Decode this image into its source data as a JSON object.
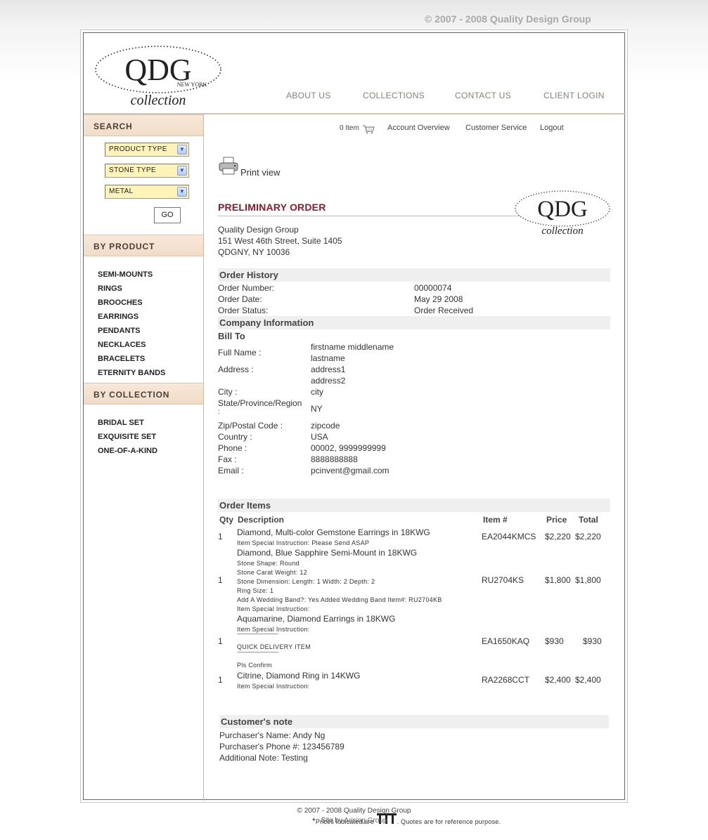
{
  "top_copyright": "© 2007 - 2008 Quality Design Group",
  "logo": {
    "main": "QDG",
    "sub": "NEW YORK",
    "script": "collection"
  },
  "nav": [
    "ABOUT US",
    "COLLECTIONS",
    "CONTACT US",
    "CLIENT LOGIN"
  ],
  "sidebar": {
    "search_heading": "SEARCH",
    "selects": [
      "PRODUCT TYPE",
      "STONE TYPE",
      "METAL"
    ],
    "go_label": "GO",
    "by_product_heading": "BY PRODUCT",
    "products": [
      "SEMI-MOUNTS",
      "RINGS",
      "BROOCHES",
      "EARRINGS",
      "PENDANTS",
      "NECKLACES",
      "BRACELETS",
      "ETERNITY BANDS"
    ],
    "by_collection_heading": "BY COLLECTION",
    "collections": [
      "BRIDAL SET",
      "EXQUISITE SET",
      "ONE-OF-A-KIND"
    ]
  },
  "topnav": {
    "cart": "0 Item",
    "account": "Account Overview",
    "service": "Customer Service",
    "logout": "Logout"
  },
  "print_view": "Print view",
  "title": "PRELIMINARY ORDER",
  "company_address": [
    "Quality Design Group",
    "151 West 46th Street, Suite 1405",
    "QDGNY, NY 10036"
  ],
  "order_history": {
    "heading": "Order History",
    "rows": [
      {
        "label": "Order Number:",
        "value": "00000074"
      },
      {
        "label": "Order Date:",
        "value": "May 29 2008"
      },
      {
        "label": "Order Status:",
        "value": "Order Received"
      }
    ]
  },
  "company_info": {
    "heading": "Company Information",
    "bill_to": "Bill To",
    "full_name_label": "Full Name :",
    "full_name": [
      "firstname middlename",
      "lastname"
    ],
    "address_label": "Address :",
    "address": [
      "address1",
      "address2"
    ],
    "city_label": "City :",
    "city": "city",
    "state_label": [
      "State/Province/Region",
      ":"
    ],
    "state": "NY",
    "zip_label": "Zip/Postal Code :",
    "zip": "zipcode",
    "country_label": "Country :",
    "country": "USA",
    "phone_label": "Phone :",
    "phone": "00002, 9999999999",
    "fax_label": "Fax :",
    "fax": "8888888888",
    "email_label": "Email :",
    "email": "pcinvent@gmail.com"
  },
  "order_items": {
    "heading": "Order Items",
    "columns": {
      "qty": "Qty",
      "desc": "Description",
      "item": "Item #",
      "price": "Price",
      "total": "Total"
    },
    "items": [
      {
        "qty": "1",
        "desc": "Diamond, Multi-color Gemstone Earrings in 18KWG",
        "notes": [
          "Item Special Instruction: Please Send ASAP"
        ],
        "item": "EA2044KMCS",
        "price": "$2,220",
        "total": "$2,220"
      },
      {
        "qty": "1",
        "desc": "Diamond, Blue Sapphire Semi-Mount in 18KWG",
        "notes": [
          "Stone Shape: Round",
          "Stone Carat Weight: 12",
          "Stone Dimension: Length: 1 Width: 2 Depth: 2",
          "Ring Size: 1",
          "Add A Wedding Band?: Yes Added Wedding Band Item#: RU2704KB",
          "Item Special Instruction:"
        ],
        "item": "RU2704KS",
        "price": "$1,800",
        "total": "$1,800"
      },
      {
        "qty": "1",
        "desc": "Aquamarine, Diamond Earrings in 18KWG",
        "notes": [
          "Item Special Instruction:",
          "--------------------------------",
          "QUICK DELIVERY ITEM",
          "--------------------------------",
          "Pls Confirm"
        ],
        "item": "EA1650KAQ",
        "price": "$930",
        "total": "$930"
      },
      {
        "qty": "1",
        "desc": "Citrine, Diamond Ring in 14KWG",
        "notes": [
          "Item Special Instruction:"
        ],
        "item": "RA2268CCT",
        "price": "$2,400",
        "total": "$2,400"
      }
    ]
  },
  "customer_note": {
    "heading": "Customer's note",
    "lines": [
      "Purchaser's Name: Andy Ng",
      "Purchaser's Phone #: 123456789",
      "Additional Note: Testing"
    ]
  },
  "footnote": {
    "star": "*",
    "before": "Prices indicated are",
    "after": ". Quotes are for reference purpose."
  },
  "footer": {
    "copyright": "© 2007 - 2008 Quality Design Group",
    "site_by": "Site by",
    "credit": "Arising Group"
  }
}
